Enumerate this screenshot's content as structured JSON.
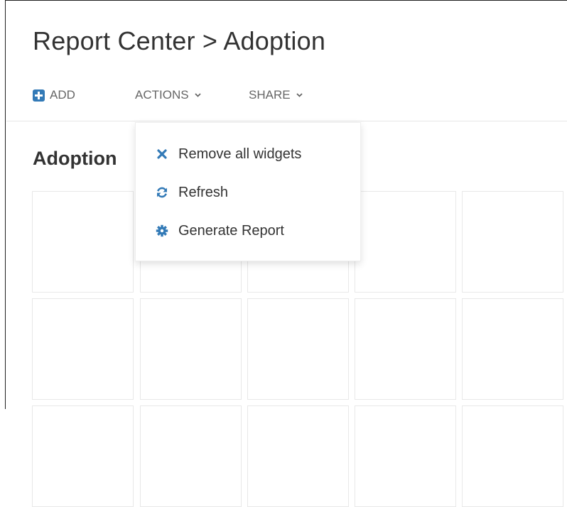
{
  "header": {
    "title": "Report Center > Adoption"
  },
  "toolbar": {
    "add_label": "ADD",
    "actions_label": "ACTIONS",
    "share_label": "SHARE"
  },
  "content": {
    "section_title": "Adoption"
  },
  "actions_menu": {
    "items": [
      {
        "label": "Remove all widgets",
        "icon": "times-icon"
      },
      {
        "label": "Refresh",
        "icon": "refresh-icon"
      },
      {
        "label": "Generate Report",
        "icon": "gear-icon"
      }
    ]
  },
  "colors": {
    "accent": "#337ab7",
    "text_dark": "#333333",
    "text_muted": "#666666",
    "tile_border": "#e8e8e8"
  }
}
